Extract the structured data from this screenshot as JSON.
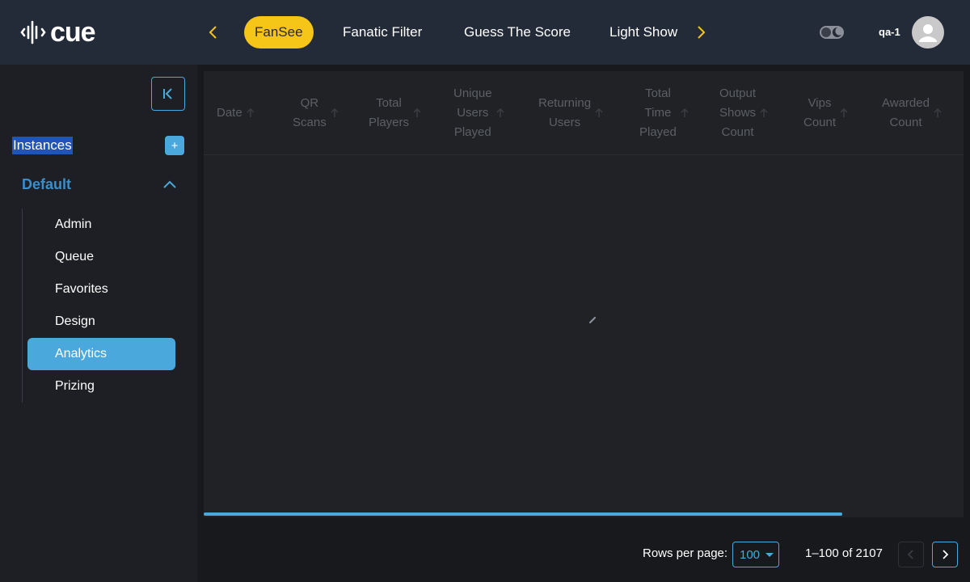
{
  "header": {
    "logo_text": "cue",
    "tabs": [
      {
        "label": "FanSee",
        "active": true
      },
      {
        "label": "Fanatic Filter",
        "active": false
      },
      {
        "label": "Guess The Score",
        "active": false
      },
      {
        "label": "Light Show",
        "active": false
      }
    ],
    "user_name": "qa-1"
  },
  "sidebar": {
    "instances_label": "Instances",
    "add_label": "+",
    "group_label": "Default",
    "items": [
      {
        "label": "Admin"
      },
      {
        "label": "Queue"
      },
      {
        "label": "Favorites"
      },
      {
        "label": "Design"
      },
      {
        "label": "Analytics",
        "active": true
      },
      {
        "label": "Prizing"
      }
    ]
  },
  "table": {
    "columns": [
      [
        "Date"
      ],
      [
        "QR",
        "Scans"
      ],
      [
        "Total",
        "Players"
      ],
      [
        "Unique",
        "Users",
        "Played"
      ],
      [
        "Returning",
        "Users"
      ],
      [
        "Total",
        "Time",
        "Played"
      ],
      [
        "Output",
        "Shows",
        "Count"
      ],
      [
        "Vips",
        "Count"
      ],
      [
        "Awarded",
        "Count"
      ]
    ]
  },
  "pagination": {
    "rows_per_page_label": "Rows per page:",
    "rows_per_page_value": "100",
    "range_text": "1–100 of 2107"
  },
  "colors": {
    "accent": "#4aa8dc",
    "active_tab": "#f5c518",
    "header_bg": "#232a38",
    "sidebar_bg": "#1e1f24",
    "content_bg": "#18191c"
  }
}
